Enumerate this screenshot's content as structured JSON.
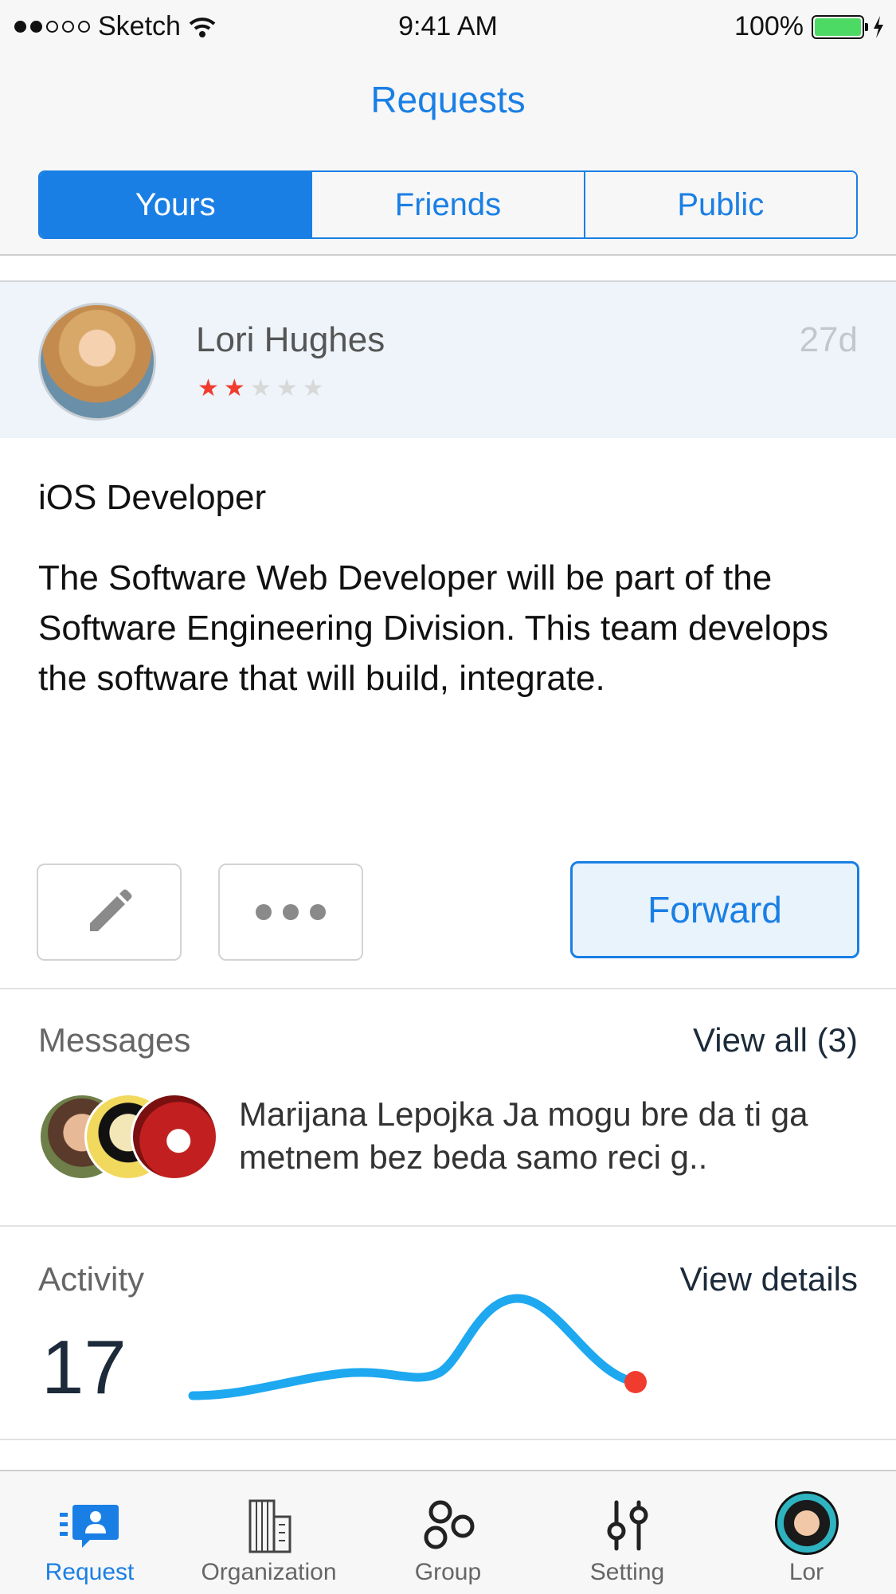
{
  "status_bar": {
    "carrier": "Sketch",
    "signal_dots_filled": 2,
    "signal_dots_total": 5,
    "time": "9:41 AM",
    "battery_percent": "100%",
    "battery_level": 1.0
  },
  "nav": {
    "title": "Requests",
    "segments": [
      {
        "label": "Yours",
        "active": true
      },
      {
        "label": "Friends",
        "active": false
      },
      {
        "label": "Public",
        "active": false
      }
    ]
  },
  "request": {
    "user_name": "Lori Hughes",
    "rating": 2,
    "rating_max": 5,
    "age": "27d",
    "title": "iOS Developer",
    "description": "The Software Web Developer will be part of the Software Engineering Division. This team develops the software that will build, integrate."
  },
  "actions": {
    "edit_icon": "pencil-icon",
    "more_icon": "more-dots-icon",
    "forward_label": "Forward"
  },
  "messages": {
    "label": "Messages",
    "view_all": "View all (3)",
    "preview": "Marijana Lepojka Ja mogu bre da ti ga metnem bez beda samo reci  g.."
  },
  "activity": {
    "label": "Activity",
    "view_details": "View details",
    "count": "17",
    "line_color": "#1ea8f0",
    "endpoint_color": "#f03c2e"
  },
  "colors": {
    "accent": "#1a7fe5",
    "star_on": "#f03c2e",
    "star_off": "#d8d8d8"
  },
  "tabbar": {
    "tabs": [
      {
        "label": "Request",
        "icon": "request-icon",
        "active": true
      },
      {
        "label": "Organization",
        "icon": "building-icon",
        "active": false
      },
      {
        "label": "Group",
        "icon": "group-icon",
        "active": false
      },
      {
        "label": "Setting",
        "icon": "sliders-icon",
        "active": false
      },
      {
        "label": "Lor",
        "icon": "profile-avatar",
        "active": false
      }
    ]
  }
}
